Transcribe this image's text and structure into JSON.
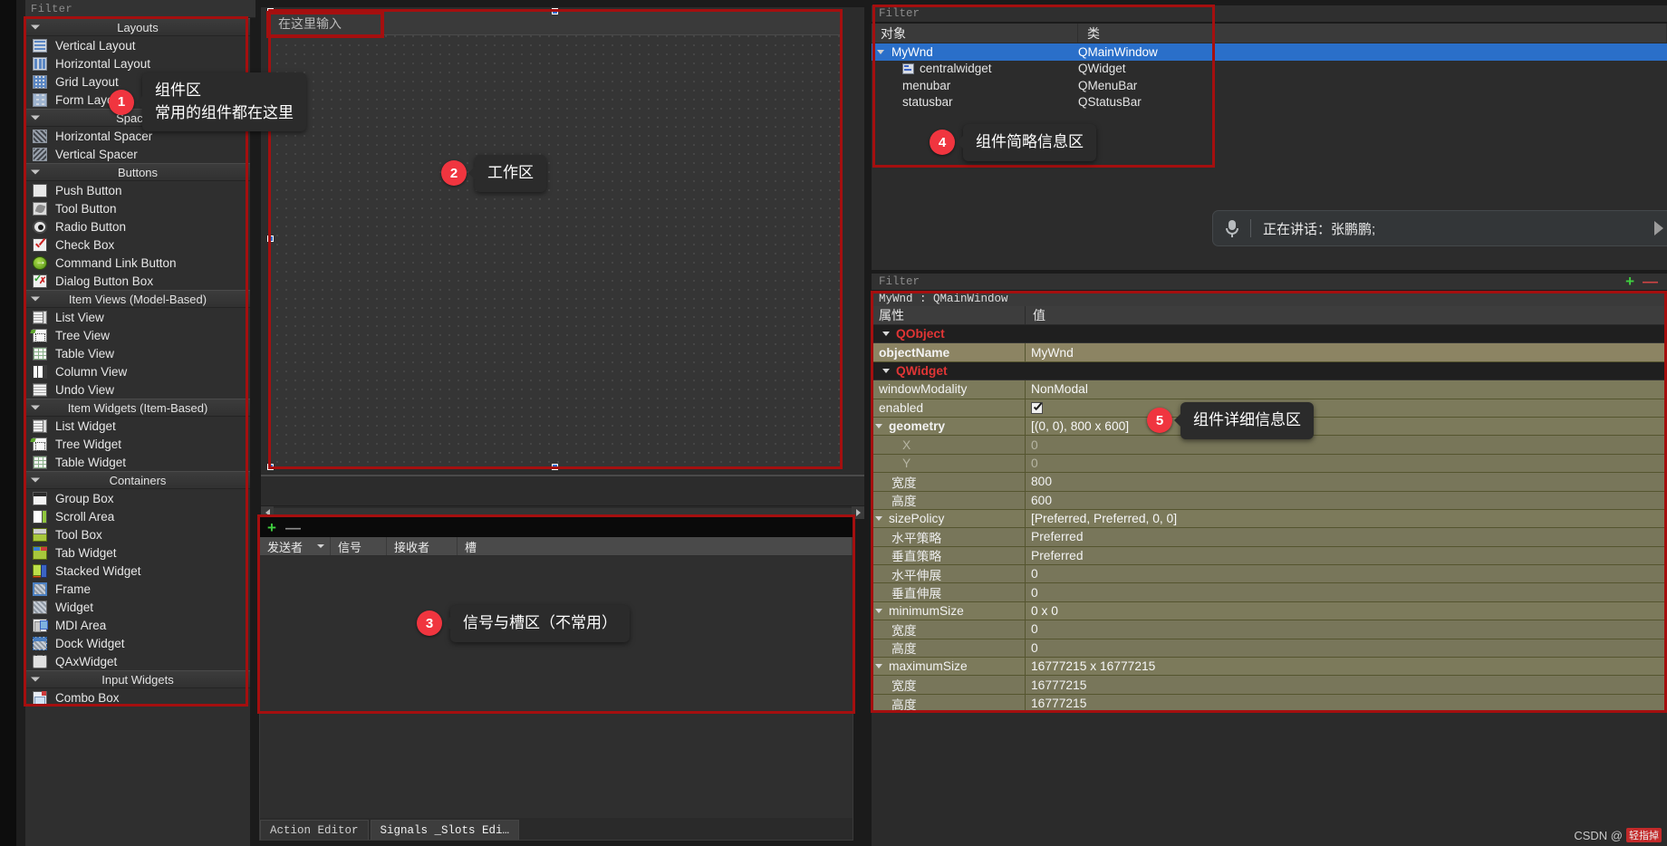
{
  "widget_box": {
    "filter_placeholder": "Filter",
    "categories": [
      {
        "name": "Layouts",
        "items": [
          {
            "label": "Vertical Layout",
            "icon": "vertical-layout-icon"
          },
          {
            "label": "Horizontal Layout",
            "icon": "horizontal-layout-icon"
          },
          {
            "label": "Grid Layout",
            "icon": "grid-layout-icon"
          },
          {
            "label": "Form Layout",
            "icon": "form-layout-icon"
          }
        ]
      },
      {
        "name": "Spacers",
        "items": [
          {
            "label": "Horizontal Spacer",
            "icon": "horizontal-spacer-icon"
          },
          {
            "label": "Vertical Spacer",
            "icon": "vertical-spacer-icon"
          }
        ]
      },
      {
        "name": "Buttons",
        "items": [
          {
            "label": "Push Button",
            "icon": "push-button-icon"
          },
          {
            "label": "Tool Button",
            "icon": "tool-button-icon"
          },
          {
            "label": "Radio Button",
            "icon": "radio-button-icon"
          },
          {
            "label": "Check Box",
            "icon": "check-box-icon"
          },
          {
            "label": "Command Link Button",
            "icon": "command-link-button-icon"
          },
          {
            "label": "Dialog Button Box",
            "icon": "dialog-button-box-icon"
          }
        ]
      },
      {
        "name": "Item Views (Model-Based)",
        "items": [
          {
            "label": "List View",
            "icon": "list-view-icon"
          },
          {
            "label": "Tree View",
            "icon": "tree-view-icon"
          },
          {
            "label": "Table View",
            "icon": "table-view-icon"
          },
          {
            "label": "Column View",
            "icon": "column-view-icon"
          },
          {
            "label": "Undo View",
            "icon": "undo-view-icon"
          }
        ]
      },
      {
        "name": "Item Widgets (Item-Based)",
        "items": [
          {
            "label": "List Widget",
            "icon": "list-widget-icon"
          },
          {
            "label": "Tree Widget",
            "icon": "tree-widget-icon"
          },
          {
            "label": "Table Widget",
            "icon": "table-widget-icon"
          }
        ]
      },
      {
        "name": "Containers",
        "items": [
          {
            "label": "Group Box",
            "icon": "group-box-icon"
          },
          {
            "label": "Scroll Area",
            "icon": "scroll-area-icon"
          },
          {
            "label": "Tool Box",
            "icon": "tool-box-icon"
          },
          {
            "label": "Tab Widget",
            "icon": "tab-widget-icon"
          },
          {
            "label": "Stacked Widget",
            "icon": "stacked-widget-icon"
          },
          {
            "label": "Frame",
            "icon": "frame-icon"
          },
          {
            "label": "Widget",
            "icon": "widget-icon"
          },
          {
            "label": "MDI Area",
            "icon": "mdi-area-icon"
          },
          {
            "label": "Dock Widget",
            "icon": "dock-widget-icon"
          },
          {
            "label": "QAxWidget",
            "icon": "qax-widget-icon"
          }
        ]
      },
      {
        "name": "Input Widgets",
        "items": [
          {
            "label": "Combo Box",
            "icon": "combo-box-icon"
          }
        ]
      }
    ]
  },
  "form_editor": {
    "menubar_placeholder": "在这里输入"
  },
  "signal_slot_editor": {
    "add_label": "+",
    "remove_label": "—",
    "columns": [
      "发送者",
      "信号",
      "接收者",
      "槽"
    ],
    "tabs": [
      {
        "label": "Action Editor",
        "active": false
      },
      {
        "label": "Signals _Slots Edi…",
        "active": true
      }
    ]
  },
  "object_inspector": {
    "filter_placeholder": "Filter",
    "columns": [
      "对象",
      "类"
    ],
    "rows": [
      {
        "name": "MyWnd",
        "class": "QMainWindow",
        "indent": 0,
        "selected": true,
        "expander": true,
        "icon": ""
      },
      {
        "name": "centralwidget",
        "class": "QWidget",
        "indent": 1,
        "selected": false,
        "expander": false,
        "icon": "central-widget-icon"
      },
      {
        "name": "menubar",
        "class": "QMenuBar",
        "indent": 1,
        "selected": false,
        "expander": false,
        "icon": ""
      },
      {
        "name": "statusbar",
        "class": "QStatusBar",
        "indent": 1,
        "selected": false,
        "expander": false,
        "icon": ""
      }
    ]
  },
  "voice_banner": {
    "icon": "microphone-icon",
    "text": "正在讲话：张鹏鹏;"
  },
  "property_editor": {
    "filter_placeholder": "Filter",
    "title": "MyWnd : QMainWindow",
    "columns": [
      "属性",
      "值"
    ],
    "rows": [
      {
        "name": "QObject",
        "value": "",
        "type": "group"
      },
      {
        "name": "objectName",
        "value": "MyWnd",
        "type": "lvl0",
        "bold": true,
        "highlight": true
      },
      {
        "name": "QWidget",
        "value": "",
        "type": "group"
      },
      {
        "name": "windowModality",
        "value": "NonModal",
        "type": "lvl0"
      },
      {
        "name": "enabled",
        "value": "",
        "type": "lvl0",
        "checkbox": true
      },
      {
        "name": "geometry",
        "value": "[(0, 0), 800 x 600]",
        "type": "lvl0",
        "bold": true,
        "expander": true
      },
      {
        "name": "X",
        "value": "0",
        "type": "lvl2",
        "dim": true
      },
      {
        "name": "Y",
        "value": "0",
        "type": "lvl2",
        "dim": true
      },
      {
        "name": "宽度",
        "value": "800",
        "type": "lvl1"
      },
      {
        "name": "高度",
        "value": "600",
        "type": "lvl1"
      },
      {
        "name": "sizePolicy",
        "value": "[Preferred, Preferred, 0, 0]",
        "type": "lvl0",
        "expander": true
      },
      {
        "name": "水平策略",
        "value": "Preferred",
        "type": "lvl1"
      },
      {
        "name": "垂直策略",
        "value": "Preferred",
        "type": "lvl1"
      },
      {
        "name": "水平伸展",
        "value": "0",
        "type": "lvl1"
      },
      {
        "name": "垂直伸展",
        "value": "0",
        "type": "lvl1"
      },
      {
        "name": "minimumSize",
        "value": "0 x 0",
        "type": "lvl0",
        "expander": true
      },
      {
        "name": "宽度",
        "value": "0",
        "type": "lvl1"
      },
      {
        "name": "高度",
        "value": "0",
        "type": "lvl1"
      },
      {
        "name": "maximumSize",
        "value": "16777215 x 16777215",
        "type": "lvl0",
        "expander": true
      },
      {
        "name": "宽度",
        "value": "16777215",
        "type": "lvl1"
      },
      {
        "name": "高度",
        "value": "16777215",
        "type": "lvl1"
      }
    ]
  },
  "annotations": [
    {
      "number": "1",
      "text": "组件区\n常用的组件都在这里"
    },
    {
      "number": "2",
      "text": "工作区"
    },
    {
      "number": "3",
      "text": "信号与槽区（不常用）"
    },
    {
      "number": "4",
      "text": "组件简略信息区"
    },
    {
      "number": "5",
      "text": "组件详细信息区"
    }
  ],
  "watermark": {
    "prefix": "CSDN @",
    "name": "轻指掉"
  },
  "colors": {
    "accent_selection": "#2a6fc9",
    "annotation_badge": "#f0353f",
    "annotation_box": "#a50f0f",
    "property_row": "#7c7a5b",
    "group_label": "#e03535"
  }
}
